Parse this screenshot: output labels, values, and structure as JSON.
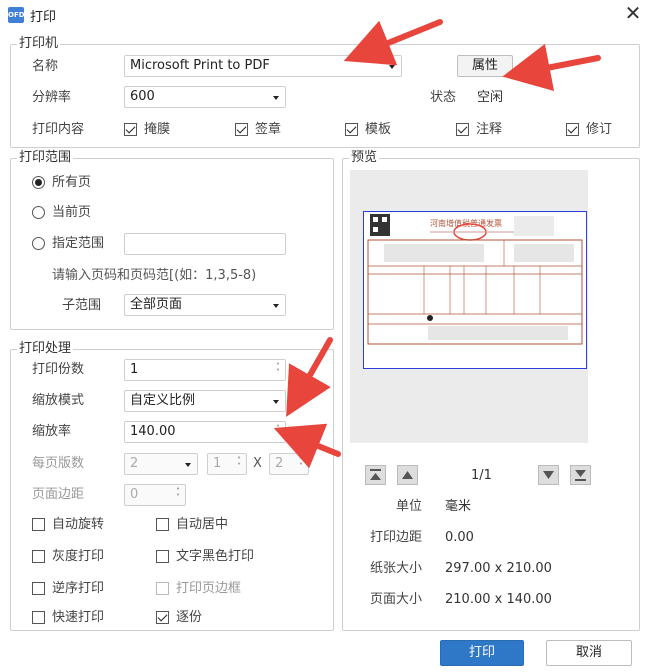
{
  "window": {
    "title": "打印",
    "app_icon_text": "OFD"
  },
  "printer_group": {
    "legend": "打印机",
    "name_label": "名称",
    "printer_value": "Microsoft Print to PDF",
    "properties_button": "属性",
    "resolution_label": "分辨率",
    "resolution_value": "600",
    "status_label": "状态",
    "status_value": "空闲",
    "content_label": "打印内容",
    "content_options": [
      {
        "label": "掩膜",
        "checked": true
      },
      {
        "label": "签章",
        "checked": true
      },
      {
        "label": "模板",
        "checked": true
      },
      {
        "label": "注释",
        "checked": true
      },
      {
        "label": "修订",
        "checked": true
      }
    ]
  },
  "range_group": {
    "legend": "打印范围",
    "all_pages": "所有页",
    "current_page": "当前页",
    "specify_range": "指定范围",
    "range_placeholder": "",
    "hint": "请输入页码和页码范[(如：1,3,5-8)",
    "subrange_label": "子范围",
    "subrange_value": "全部页面"
  },
  "process_group": {
    "legend": "打印处理",
    "copies_label": "打印份数",
    "copies_value": "1",
    "scale_mode_label": "缩放模式",
    "scale_mode_value": "自定义比例",
    "scale_rate_label": "缩放率",
    "scale_rate_value": "140.00",
    "pages_per_sheet_label": "每页版数",
    "pages_per_sheet_value": "2",
    "grid_cols": "1",
    "grid_x": "X",
    "grid_rows": "2",
    "margin_label": "页面边距",
    "margin_value": "0",
    "options": [
      {
        "label": "自动旋转",
        "checked": false,
        "disabled": false
      },
      {
        "label": "自动居中",
        "checked": false,
        "disabled": false
      },
      {
        "label": "灰度打印",
        "checked": false,
        "disabled": false
      },
      {
        "label": "文字黑色打印",
        "checked": false,
        "disabled": false
      },
      {
        "label": "逆序打印",
        "checked": false,
        "disabled": false
      },
      {
        "label": "打印页边框",
        "checked": false,
        "disabled": true
      },
      {
        "label": "快速打印",
        "checked": false,
        "disabled": false
      },
      {
        "label": "逐份",
        "checked": true,
        "disabled": false
      }
    ]
  },
  "preview_group": {
    "legend": "预览",
    "invoice_title": "河南增值税普通发票",
    "page_indicator": "1/1",
    "unit_label": "单位",
    "unit_value": "毫米",
    "print_margin_label": "打印边距",
    "print_margin_value": "0.00",
    "paper_size_label": "纸张大小",
    "paper_size_value": "297.00 x 210.00",
    "page_size_label": "页面大小",
    "page_size_value": "210.00 x 140.00"
  },
  "footer": {
    "print_button": "打印",
    "cancel_button": "取消"
  },
  "colors": {
    "accent": "#2f78c7",
    "annotation_arrow": "#e8453c",
    "preview_border": "#2d3ce0"
  }
}
